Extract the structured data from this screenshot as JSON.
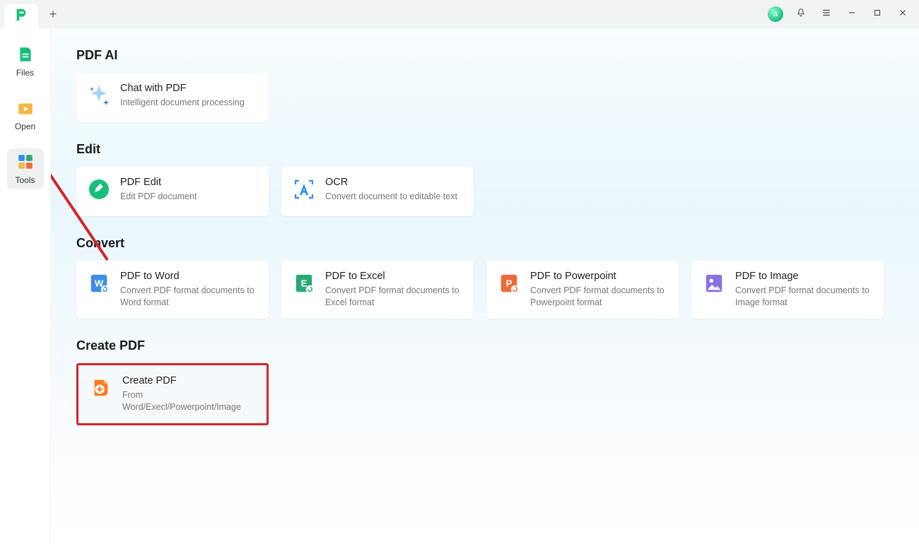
{
  "titlebar": {
    "new_tab_glyph": "+",
    "status_badge": "a",
    "buttons": {
      "notifications": "Notifications",
      "menu": "Menu",
      "minimize": "Minimize",
      "maximize": "Maximize",
      "close": "Close"
    }
  },
  "sidebar": {
    "items": [
      {
        "label": "Files"
      },
      {
        "label": "Open"
      },
      {
        "label": "Tools"
      }
    ],
    "active_index": 2
  },
  "sections": {
    "pdf_ai": {
      "title": "PDF AI",
      "cards": [
        {
          "title": "Chat with PDF",
          "desc": "Intelligent document processing"
        }
      ]
    },
    "edit": {
      "title": "Edit",
      "cards": [
        {
          "title": "PDF Edit",
          "desc": "Edit PDF document"
        },
        {
          "title": "OCR",
          "desc": "Convert document to editable text"
        }
      ]
    },
    "convert": {
      "title": "Convert",
      "cards": [
        {
          "title": "PDF to Word",
          "desc": "Convert PDF format documents to Word format"
        },
        {
          "title": "PDF to Excel",
          "desc": "Convert PDF format documents to Excel format"
        },
        {
          "title": "PDF to Powerpoint",
          "desc": "Convert PDF format documents to Powerpoint format"
        },
        {
          "title": "PDF to Image",
          "desc": "Convert PDF format documents to Image format"
        }
      ]
    },
    "create": {
      "title": "Create PDF",
      "cards": [
        {
          "title": "Create PDF",
          "desc": "From Word/Execl/Powerpoint/Image"
        }
      ]
    }
  },
  "colors": {
    "word": "#3b8fe4",
    "excel": "#2aa876",
    "ppt": "#ef6a3b",
    "image": "#8a6fe8",
    "brand": "#17c07a",
    "ocr": "#2f8eed",
    "highlight": "#d6242c"
  }
}
